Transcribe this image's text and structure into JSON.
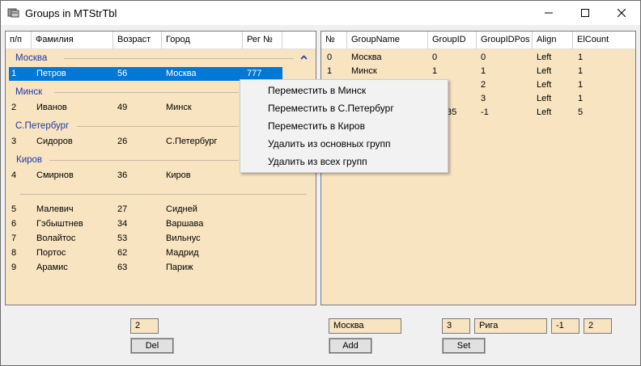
{
  "window": {
    "title": "Groups in MTStrTbl"
  },
  "left_table": {
    "headers": [
      "п/п",
      "Фамилия",
      "Возраст",
      "Город",
      "Рег №"
    ],
    "groups": [
      {
        "name": "Москва",
        "rows": [
          {
            "n": "1",
            "surname": "Петров",
            "age": "56",
            "city": "Москва",
            "reg": "777",
            "selected": true
          }
        ]
      },
      {
        "name": "Минск",
        "rows": [
          {
            "n": "2",
            "surname": "Иванов",
            "age": "49",
            "city": "Минск",
            "reg": ""
          }
        ]
      },
      {
        "name": "С.Петербург",
        "rows": [
          {
            "n": "3",
            "surname": "Сидоров",
            "age": "26",
            "city": "С.Петербург",
            "reg": ""
          }
        ]
      },
      {
        "name": "Киров",
        "rows": [
          {
            "n": "4",
            "surname": "Смирнов",
            "age": "36",
            "city": "Киров",
            "reg": ""
          }
        ]
      }
    ],
    "ungrouped_rows": [
      {
        "n": "5",
        "surname": "Малевич",
        "age": "27",
        "city": "Сидней"
      },
      {
        "n": "6",
        "surname": "Гэбыштнев",
        "age": "34",
        "city": "Варшава"
      },
      {
        "n": "7",
        "surname": "Волайтос",
        "age": "53",
        "city": "Вильнус"
      },
      {
        "n": "8",
        "surname": "Портос",
        "age": "62",
        "city": "Мадрид"
      },
      {
        "n": "9",
        "surname": "Арамис",
        "age": "63",
        "city": "Париж"
      }
    ]
  },
  "right_table": {
    "headers": [
      "№",
      "GroupName",
      "GroupID",
      "GroupIDPos",
      "Align",
      "ElCount"
    ],
    "rows": [
      {
        "n": "0",
        "name": "Москва",
        "id": "0",
        "pos": "0",
        "align": "Left",
        "count": "1"
      },
      {
        "n": "1",
        "name": "Минск",
        "id": "1",
        "pos": "1",
        "align": "Left",
        "count": "1"
      },
      {
        "n": "",
        "name": "",
        "id": "",
        "pos": "2",
        "align": "Left",
        "count": "1"
      },
      {
        "n": "",
        "name": "",
        "id": "",
        "pos": "3",
        "align": "Left",
        "count": "1"
      },
      {
        "n": "",
        "name": "",
        "id": "35",
        "pos": "-1",
        "align": "Left",
        "count": "5"
      }
    ]
  },
  "context_menu": {
    "items": [
      "Переместить в Минск",
      "Переместить в С.Петербург",
      "Переместить в Киров",
      "Удалить из основных групп",
      "Удалить из всех групп"
    ]
  },
  "controls": {
    "del_index": "2",
    "del_label": "Del",
    "add_name": "Москва",
    "add_label": "Add",
    "set_index": "3",
    "set_name": "Рига",
    "set_pos": "-1",
    "set_count": "2",
    "set_label": "Set"
  }
}
